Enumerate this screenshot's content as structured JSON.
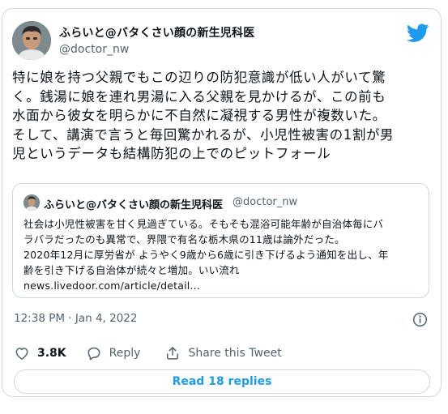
{
  "tweet": {
    "author": {
      "display_name": "ふらいと@バタくさい顔の新生児科医",
      "handle": "@doctor_nw"
    },
    "text_lines": [
      "特に娘を持つ父親でもこの辺りの防犯意識が低い人がいて驚",
      "く。銭湯に娘を連れ男湯に入る父親を見かけるが、この前も",
      "水面から彼女を明らかに不自然に凝視する男性が複数いた。",
      "そして、講演で言うと毎回驚かれるが、小児性被害の1割が男",
      "児というデータも結構防犯の上でのピットフォール"
    ],
    "timestamp": "12:38 PM · Jan 4, 2022",
    "actions": {
      "likes": "3.8K",
      "reply_label": "Reply",
      "share_label": "Share this Tweet"
    },
    "read_replies_label": "Read 18 replies",
    "brand_color": "#1d9bf0"
  },
  "quoted_tweet": {
    "display_name": "ふらいと@バタくさい顔の新生児科医",
    "handle": "@doctor_nw",
    "text_lines": [
      "社会は小児性被害を甘く見過ぎている。そもそも混浴可能年齢が自治体毎にバ",
      "ラバラだったのも異常で、界隈で有名な栃木県の11歳は論外だった。",
      "2020年12月に厚労省が ようやく9歳から6歳に引き下げるよう通知を出し、年",
      "齢を引き下げる自治体が続々と増加。いい流れ",
      "news.livedoor.com/article/detail..."
    ]
  },
  "icons": [
    "avatar",
    "twitter-bird-icon",
    "info-icon",
    "heart-icon",
    "reply-icon",
    "share-icon"
  ]
}
